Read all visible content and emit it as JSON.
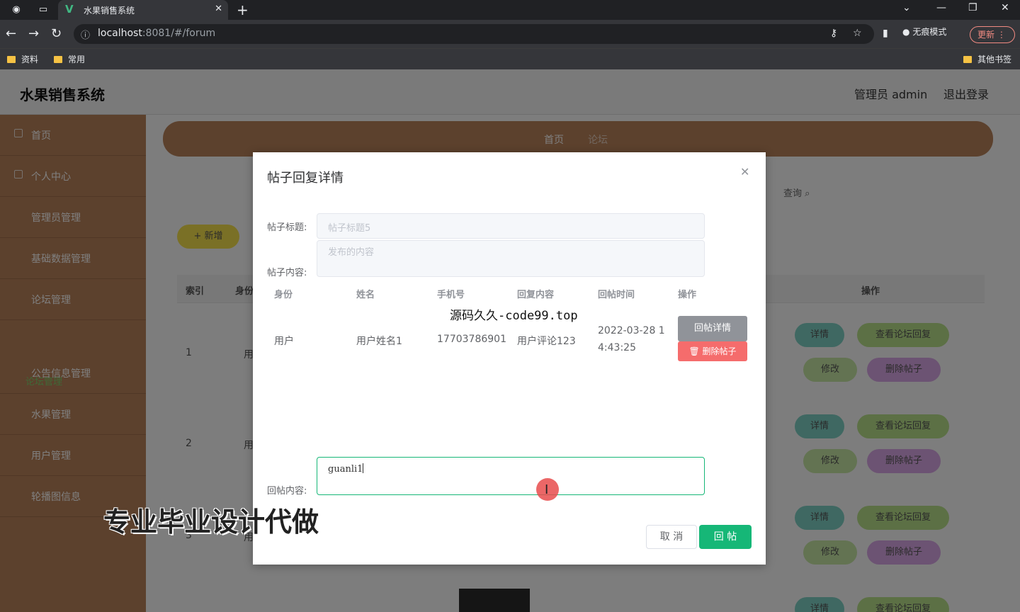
{
  "browser": {
    "tab_title": "水果销售系统",
    "url_host": "localhost",
    "url_rest": ":8081/#/forum",
    "incognito_label": "无痕模式",
    "update_label": "更新",
    "bookmarks": [
      "资料",
      "常用"
    ],
    "other_bookmarks": "其他书签"
  },
  "app": {
    "title": "水果销售系统",
    "user_label": "管理员 admin",
    "logout_label": "退出登录",
    "sidebar": [
      {
        "label": "首页"
      },
      {
        "label": "个人中心"
      },
      {
        "label": "管理员管理"
      },
      {
        "label": "基础数据管理"
      },
      {
        "label": "论坛管理"
      },
      {
        "label": "公告信息管理"
      },
      {
        "label": "水果管理"
      },
      {
        "label": "用户管理"
      },
      {
        "label": "轮播图信息"
      }
    ],
    "sidebar_sub": "论坛管理",
    "breadcrumb": [
      "首页",
      "论坛"
    ],
    "search_label": "查询",
    "add_label": "新增",
    "table_headers": {
      "index": "索引",
      "identity": "身份",
      "ops": "操作"
    },
    "rows": [
      {
        "index": "1",
        "identity": "用"
      },
      {
        "index": "2",
        "identity": "用"
      },
      {
        "index": "3",
        "identity": "用"
      }
    ],
    "row_buttons": {
      "detail": "详情",
      "view_replies": "查看论坛回复",
      "edit": "修改",
      "delete": "删除帖子"
    }
  },
  "dialog": {
    "title": "帖子回复详情",
    "post_title_label": "帖子标题:",
    "post_title_value": "帖子标题5",
    "post_content_label": "帖子内容:",
    "post_content_value": "发布的内容",
    "reply_headers": [
      "身份",
      "姓名",
      "手机号",
      "回复内容",
      "回帖时间",
      "操作"
    ],
    "reply_row": {
      "identity": "用户",
      "name": "用户姓名1",
      "phone": "17703786901",
      "content": "用户评论123",
      "time_line1": "2022-03-28 1",
      "time_line2": "4:43:25"
    },
    "btn_reply_detail": "回帖详情",
    "btn_delete_post": "删除帖子",
    "reply_content_label": "回帖内容:",
    "reply_content_value": "guanli1",
    "btn_cancel": "取 消",
    "btn_submit": "回 帖"
  },
  "overlay_texts": {
    "watermark": "源码久久-code99.top",
    "promo": "专业毕业设计代做"
  }
}
